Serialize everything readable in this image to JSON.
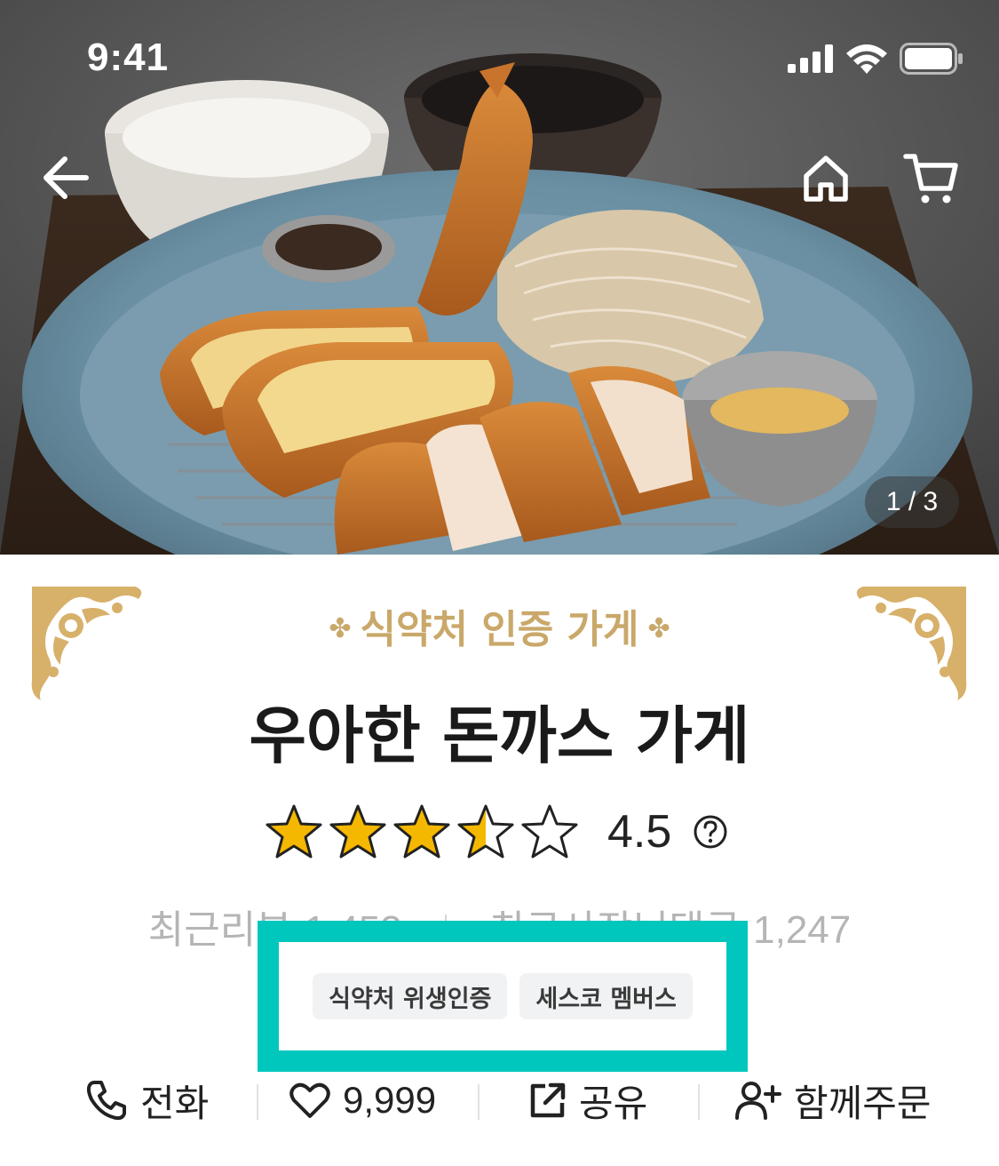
{
  "status_bar": {
    "time": "9:41"
  },
  "hero": {
    "page_indicator": "1 / 3"
  },
  "store": {
    "certification_label": "식약처 인증 가게",
    "name": "우아한 돈까스 가게",
    "rating": "4.5",
    "rating_stars": 4.5,
    "recent_reviews_label": "최근리뷰",
    "recent_reviews_count": "1,453",
    "owner_replies_label": "최근사장님댓글",
    "owner_replies_count": "1,247",
    "badges": [
      "식약처 위생인증",
      "세스코 멤버스"
    ]
  },
  "actions": {
    "call_label": "전화",
    "like_count": "9,999",
    "share_label": "공유",
    "group_order_label": "함께주문"
  },
  "colors": {
    "gold": "#c9a86a",
    "highlight": "#00c7be",
    "star": "#f5b800"
  },
  "icons": [
    "back-arrow-icon",
    "home-icon",
    "cart-icon",
    "question-icon",
    "phone-icon",
    "heart-icon",
    "share-icon",
    "add-user-icon"
  ]
}
